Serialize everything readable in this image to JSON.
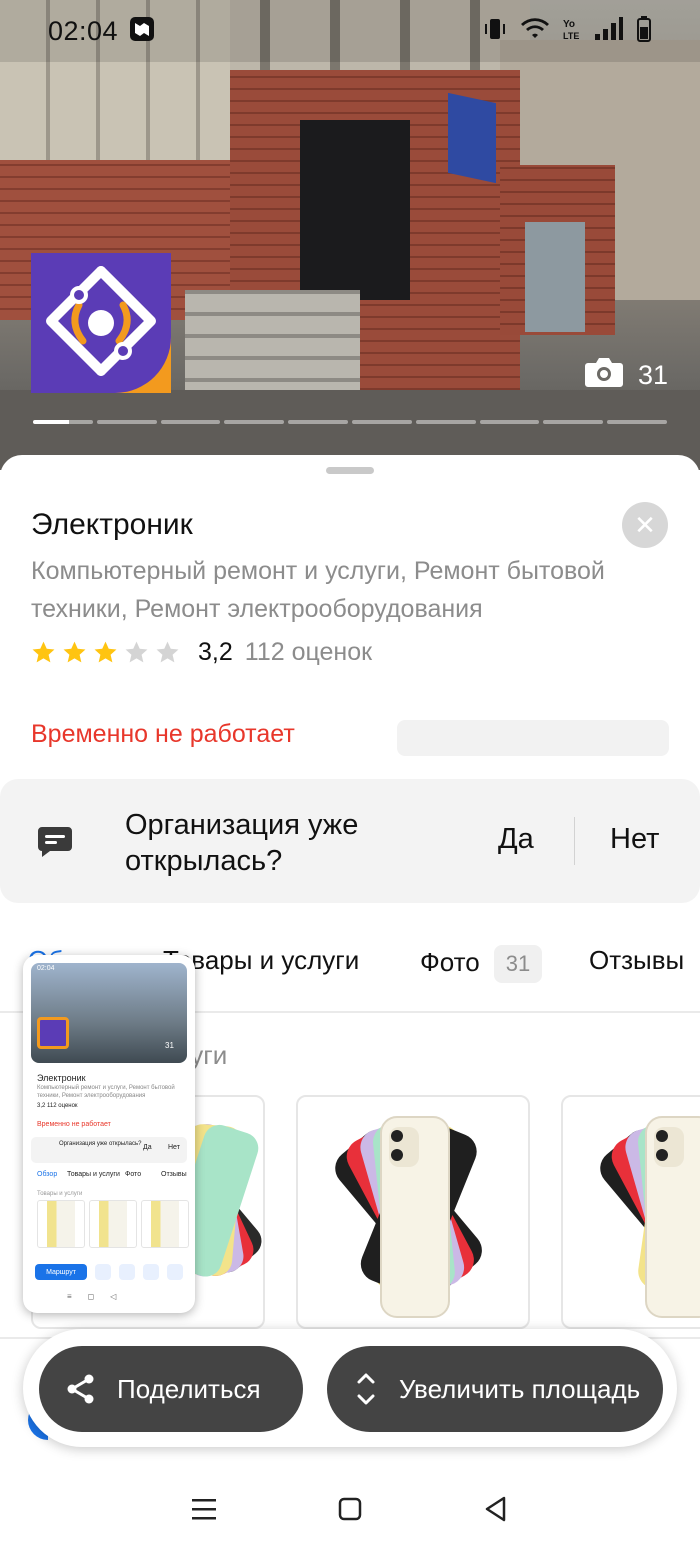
{
  "status_bar": {
    "time": "02:04"
  },
  "hero": {
    "photo_count": "31"
  },
  "place": {
    "name": "Электроник",
    "categories": "Компьютерный ремонт и услуги, Ремонт бытовой техники, Ремонт электрооборудования",
    "rating_value": "3,2",
    "rating_count": "112 оценок",
    "stars_filled": 3,
    "stars_total": 5,
    "status": "Временно не работает"
  },
  "question": {
    "text": "Организация уже открылась?",
    "yes": "Да",
    "no": "Нет"
  },
  "tabs": [
    {
      "label": "Обзор",
      "active": true
    },
    {
      "label": "Товары и услуги"
    },
    {
      "label": "Фото",
      "badge": "31"
    },
    {
      "label": "Отзывы"
    }
  ],
  "section": {
    "title": "Товары и услуги"
  },
  "actions": {
    "share": "Поделиться",
    "grow": "Увеличить площадь"
  },
  "colors": {
    "accent": "#1a73e8",
    "closed": "#e8372b",
    "pill": "#444444",
    "logo_purple": "#5b3cb6",
    "logo_orange": "#f39a1e"
  },
  "thumbnail": {
    "time": "02:04",
    "photo_count": "31",
    "name": "Электроник",
    "categories_1": "Компьютерный ремонт и услуги, Ремонт бытовой",
    "categories_2": "техники, Ремонт электрооборудования",
    "rating": "3,2  112 оценок",
    "status": "Временно не работает",
    "question": "Организация уже открылась?",
    "yes": "Да",
    "no": "Нет",
    "tab_1": "Обзор",
    "tab_2": "Товары и услуги",
    "tab_3": "Фото",
    "tab_4": "Отзывы",
    "section": "Товары и услуги",
    "route": "Маршрут"
  }
}
